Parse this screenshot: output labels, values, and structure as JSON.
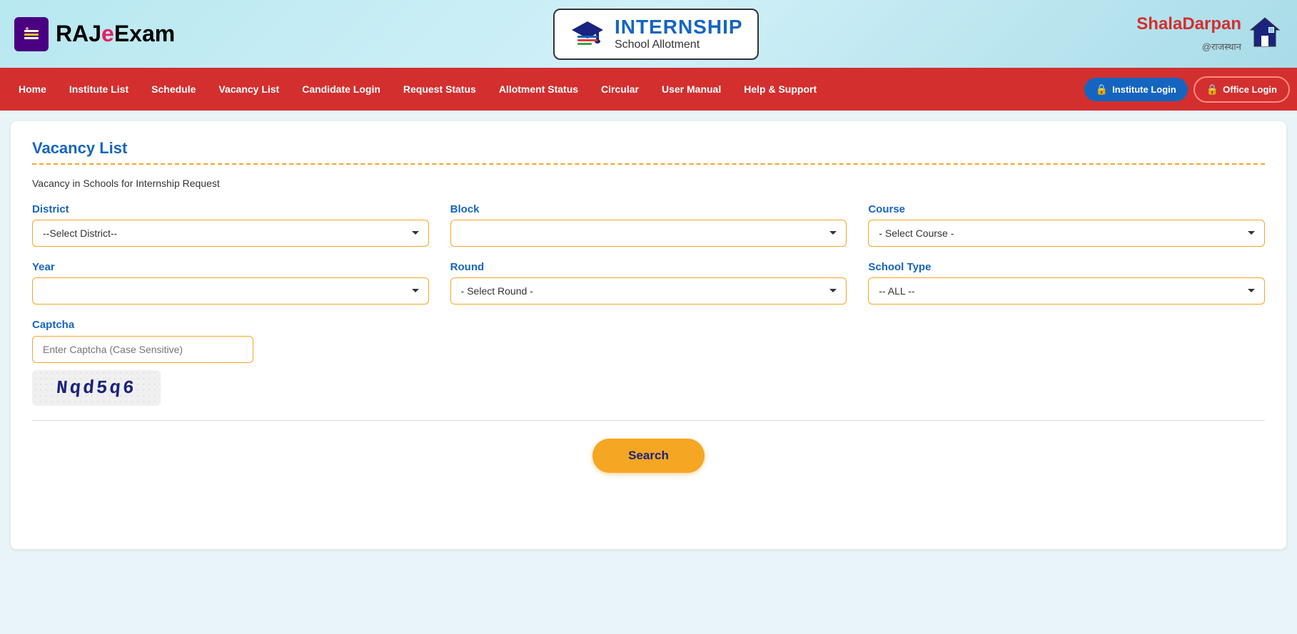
{
  "header": {
    "logo_text": "RAJeExam",
    "logo_text_je": "Je",
    "center_title": "INTERNSHIP",
    "center_subtitle": "School Allotment",
    "right_logo_line1": "Shala",
    "right_logo_line2": "Darpan",
    "right_logo_sub": "@राजस्थान"
  },
  "nav": {
    "items": [
      {
        "label": "Home",
        "id": "home"
      },
      {
        "label": "Institute List",
        "id": "institute-list"
      },
      {
        "label": "Schedule",
        "id": "schedule"
      },
      {
        "label": "Vacancy List",
        "id": "vacancy-list"
      },
      {
        "label": "Candidate Login",
        "id": "candidate-login"
      },
      {
        "label": "Request Status",
        "id": "request-status"
      },
      {
        "label": "Allotment Status",
        "id": "allotment-status"
      },
      {
        "label": "Circular",
        "id": "circular"
      },
      {
        "label": "User Manual",
        "id": "user-manual"
      },
      {
        "label": "Help & Support",
        "id": "help-support"
      }
    ],
    "institute_login_btn": "Institute Login",
    "office_login_btn": "Office Login"
  },
  "page": {
    "title": "Vacancy List",
    "subtitle": "Vacancy in Schools for Internship Request",
    "district_label": "District",
    "district_placeholder": "--Select District--",
    "block_label": "Block",
    "block_placeholder": "",
    "course_label": "Course",
    "course_placeholder": "- Select Course -",
    "year_label": "Year",
    "year_placeholder": "",
    "round_label": "Round",
    "round_placeholder": "- Select Round -",
    "school_type_label": "School Type",
    "school_type_placeholder": "-- ALL --",
    "captcha_label": "Captcha",
    "captcha_input_placeholder": "Enter Captcha (Case Sensitive)",
    "captcha_value": "Nqd5q6",
    "search_btn": "Search"
  }
}
